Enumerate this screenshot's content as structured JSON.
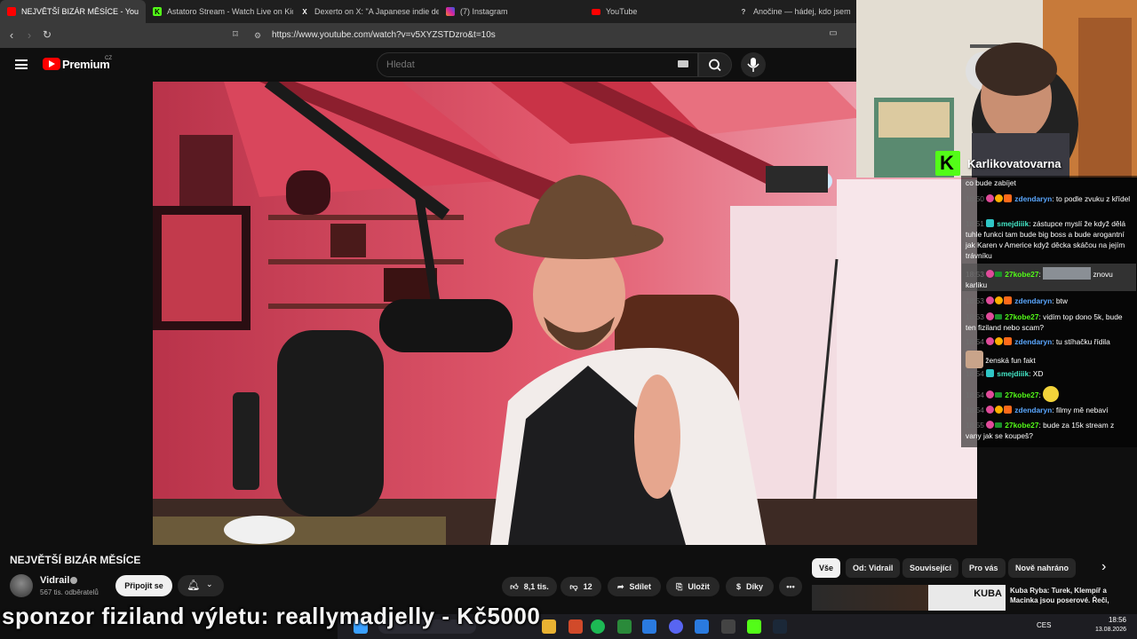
{
  "tabs": [
    {
      "title": "NEJVĚTŠÍ BIZÁR MĚSÍCE - You",
      "favicon": "youtube-icon",
      "color": "#ff0000",
      "active": true
    },
    {
      "title": "Astatoro Stream - Watch Live on Kick",
      "favicon": "kick-icon",
      "color": "#53fc18"
    },
    {
      "title": "Dexerto on X: \"A Japanese indie dev",
      "favicon": "x-icon",
      "color": "#ffffff"
    },
    {
      "title": "(7) Instagram",
      "favicon": "instagram-icon",
      "color": "#d6249f"
    },
    {
      "title": "YouTube",
      "favicon": "youtube-icon",
      "color": "#ff0000"
    },
    {
      "title": "Anočine — hádej, kdo jsem",
      "favicon": "question-icon",
      "color": "#cccccc"
    }
  ],
  "browser": {
    "close_label": "✕",
    "url": "https://www.youtube.com/watch?v=v5XYZSTDzro&t=10s"
  },
  "youtube": {
    "brand": "Premium",
    "region": "CZ",
    "search_placeholder": "Hledat"
  },
  "video": {
    "title": "NEJVĚTŠÍ BIZÁR MĚSÍCE",
    "channel": "Vidrail",
    "subscribers": "567 tis. odběratelů",
    "join_label": "Připojit se",
    "likes": "8,1 tis.",
    "dislikes": "12",
    "share_label": "Sdílet",
    "save_label": "Uložit",
    "thanks_label": "Díky"
  },
  "chips": [
    "Vše",
    "Od: Vidrail",
    "Související",
    "Pro vás",
    "Nově nahráno"
  ],
  "related": {
    "thumb_text": "KUBA",
    "title": "Kuba Ryba: Turek, Klempíř a Macinka jsou poserové. Řeči,"
  },
  "overlay": {
    "sponsor": "sponzor fiziland výletu: reallymadjelly - Kč5000",
    "streamer": "Karlikovatovarna"
  },
  "chat": [
    {
      "ts": "",
      "nick": "",
      "text": "co bude zabíjet"
    },
    {
      "ts": "18:50",
      "nick": "zdendaryn",
      "text": "to podle zvuku z křídel"
    },
    {
      "ts": "18:51",
      "nick": "smejdiiik",
      "text": "zástupce myslí že když dělá tuhle funkci tam bude big boss a bude arogantní jak Karen v Americe když děcka skáčou na jejím trávníku"
    },
    {
      "ts": "18:53",
      "nick": "27kobe27",
      "text": "znovu karliku"
    },
    {
      "ts": "18:53",
      "nick": "zdendaryn",
      "text": "btw"
    },
    {
      "ts": "18:53",
      "nick": "27kobe27",
      "text": "vidím top dono 5k, bude ten fiziland nebo scam?"
    },
    {
      "ts": "18:54",
      "nick": "zdendaryn",
      "text": "tu stíhačku řídila"
    },
    {
      "ts": "",
      "nick": "",
      "text": "ženská fun fakt"
    },
    {
      "ts": "18:54",
      "nick": "smejdiiik",
      "text": "XD"
    },
    {
      "ts": "18:54",
      "nick": "27kobe27",
      "text": ""
    },
    {
      "ts": "18:54",
      "nick": "zdendaryn",
      "text": "filmy mě nebaví"
    },
    {
      "ts": "18:55",
      "nick": "27kobe27",
      "text": "bude za 15k stream z vany jak se koupeš?"
    }
  ],
  "taskbar": {
    "lang": "CES",
    "time": "18:56",
    "date": "13.08.2026"
  }
}
